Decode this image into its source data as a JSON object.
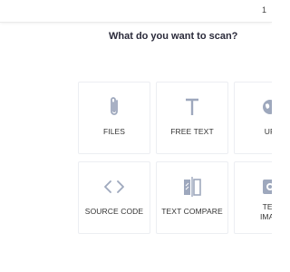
{
  "colors": {
    "icon": "#9ea8bd",
    "text": "#333333",
    "heading": "#2a2a3a",
    "card_border": "#eceef2"
  },
  "header": {
    "right_text": "1"
  },
  "main": {
    "heading": "What do you want to scan?",
    "options": [
      {
        "label": "FILES",
        "icon": "paperclip-icon"
      },
      {
        "label": "FREE TEXT",
        "icon": "text-t-icon"
      },
      {
        "label": "UR",
        "icon": "globe-icon"
      },
      {
        "label": "SOURCE CODE",
        "icon": "code-brackets-icon"
      },
      {
        "label": "TEXT COMPARE",
        "icon": "compare-icon"
      },
      {
        "label": "TEX",
        "label2": "IMAG",
        "icon": "image-icon"
      }
    ]
  }
}
